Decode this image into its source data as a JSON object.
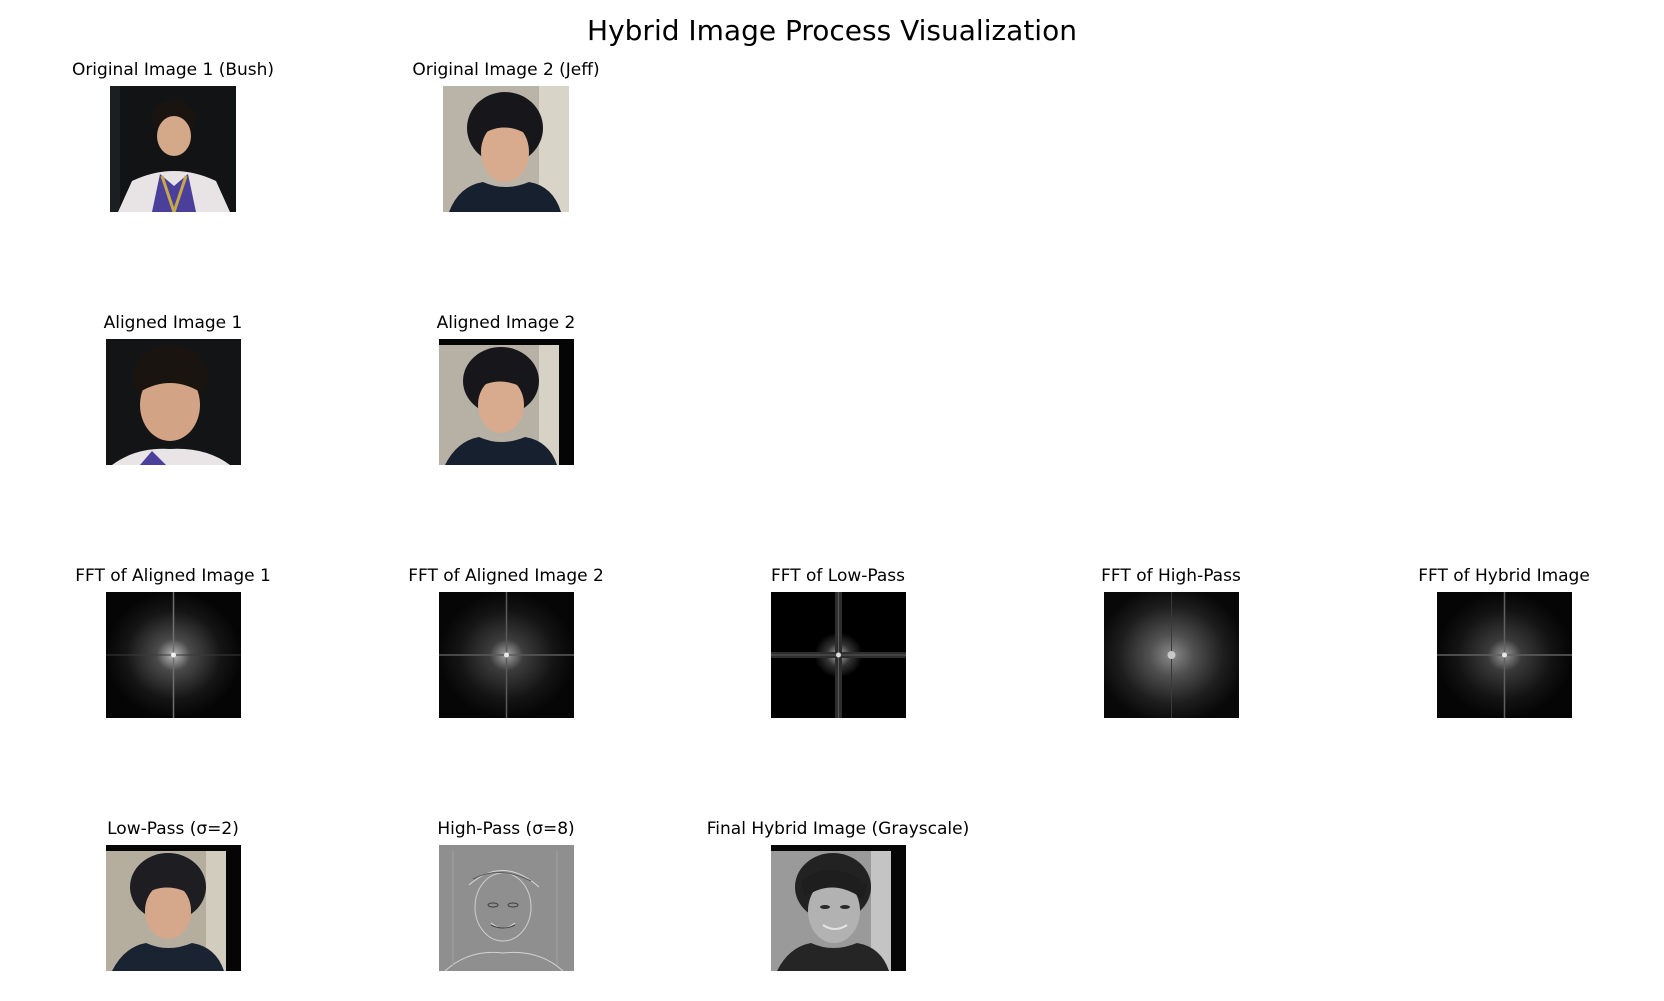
{
  "figure": {
    "title": "Hybrid Image Process Visualization"
  },
  "panels": {
    "original1": {
      "title": "Original Image 1 (Bush)"
    },
    "original2": {
      "title": "Original Image 2 (Jeff)"
    },
    "aligned1": {
      "title": "Aligned Image 1"
    },
    "aligned2": {
      "title": "Aligned Image 2"
    },
    "fft_aligned1": {
      "title": "FFT of Aligned Image 1"
    },
    "fft_aligned2": {
      "title": "FFT of Aligned Image 2"
    },
    "fft_lowpass": {
      "title": "FFT of Low-Pass"
    },
    "fft_highpass": {
      "title": "FFT of High-Pass"
    },
    "fft_hybrid": {
      "title": "FFT of Hybrid Image"
    },
    "lowpass": {
      "title": "Low-Pass (σ=2)"
    },
    "highpass": {
      "title": "High-Pass (σ=8)"
    },
    "hybrid": {
      "title": "Final Hybrid Image (Grayscale)"
    }
  }
}
